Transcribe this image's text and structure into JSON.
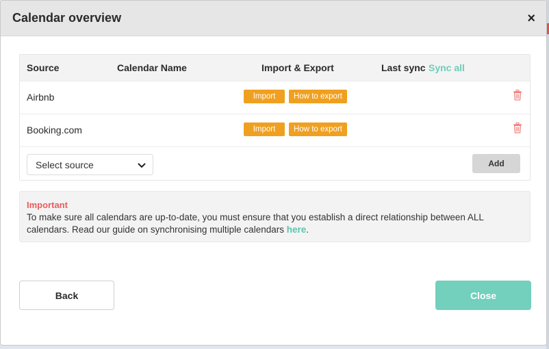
{
  "modal": {
    "title": "Calendar overview",
    "close_symbol": "×"
  },
  "table": {
    "headers": {
      "source": "Source",
      "calendar_name": "Calendar Name",
      "import_export": "Import & Export",
      "last_sync": "Last sync",
      "sync_all": "Sync all"
    },
    "rows": [
      {
        "source": "Airbnb",
        "import_label": "Import",
        "howto_label": "How to export",
        "delete_icon": "trash-icon"
      },
      {
        "source": "Booking.com",
        "import_label": "Import",
        "howto_label": "How to export",
        "delete_icon": "trash-icon"
      }
    ],
    "add_row": {
      "select_value": "Select source",
      "add_label": "Add"
    }
  },
  "notice": {
    "title": "Important",
    "text_before_link": "To make sure all calendars are up-to-date, you must ensure that you establish a direct relationship between ALL calendars. Read our guide on synchronising multiple calendars ",
    "link_text": "here",
    "text_after_link": "."
  },
  "footer": {
    "back_label": "Back",
    "close_label": "Close"
  },
  "colors": {
    "accent_teal": "#72d0bd",
    "import_orange": "#f0a020",
    "important_red": "#f05a5a",
    "trash_red": "#f08080"
  }
}
